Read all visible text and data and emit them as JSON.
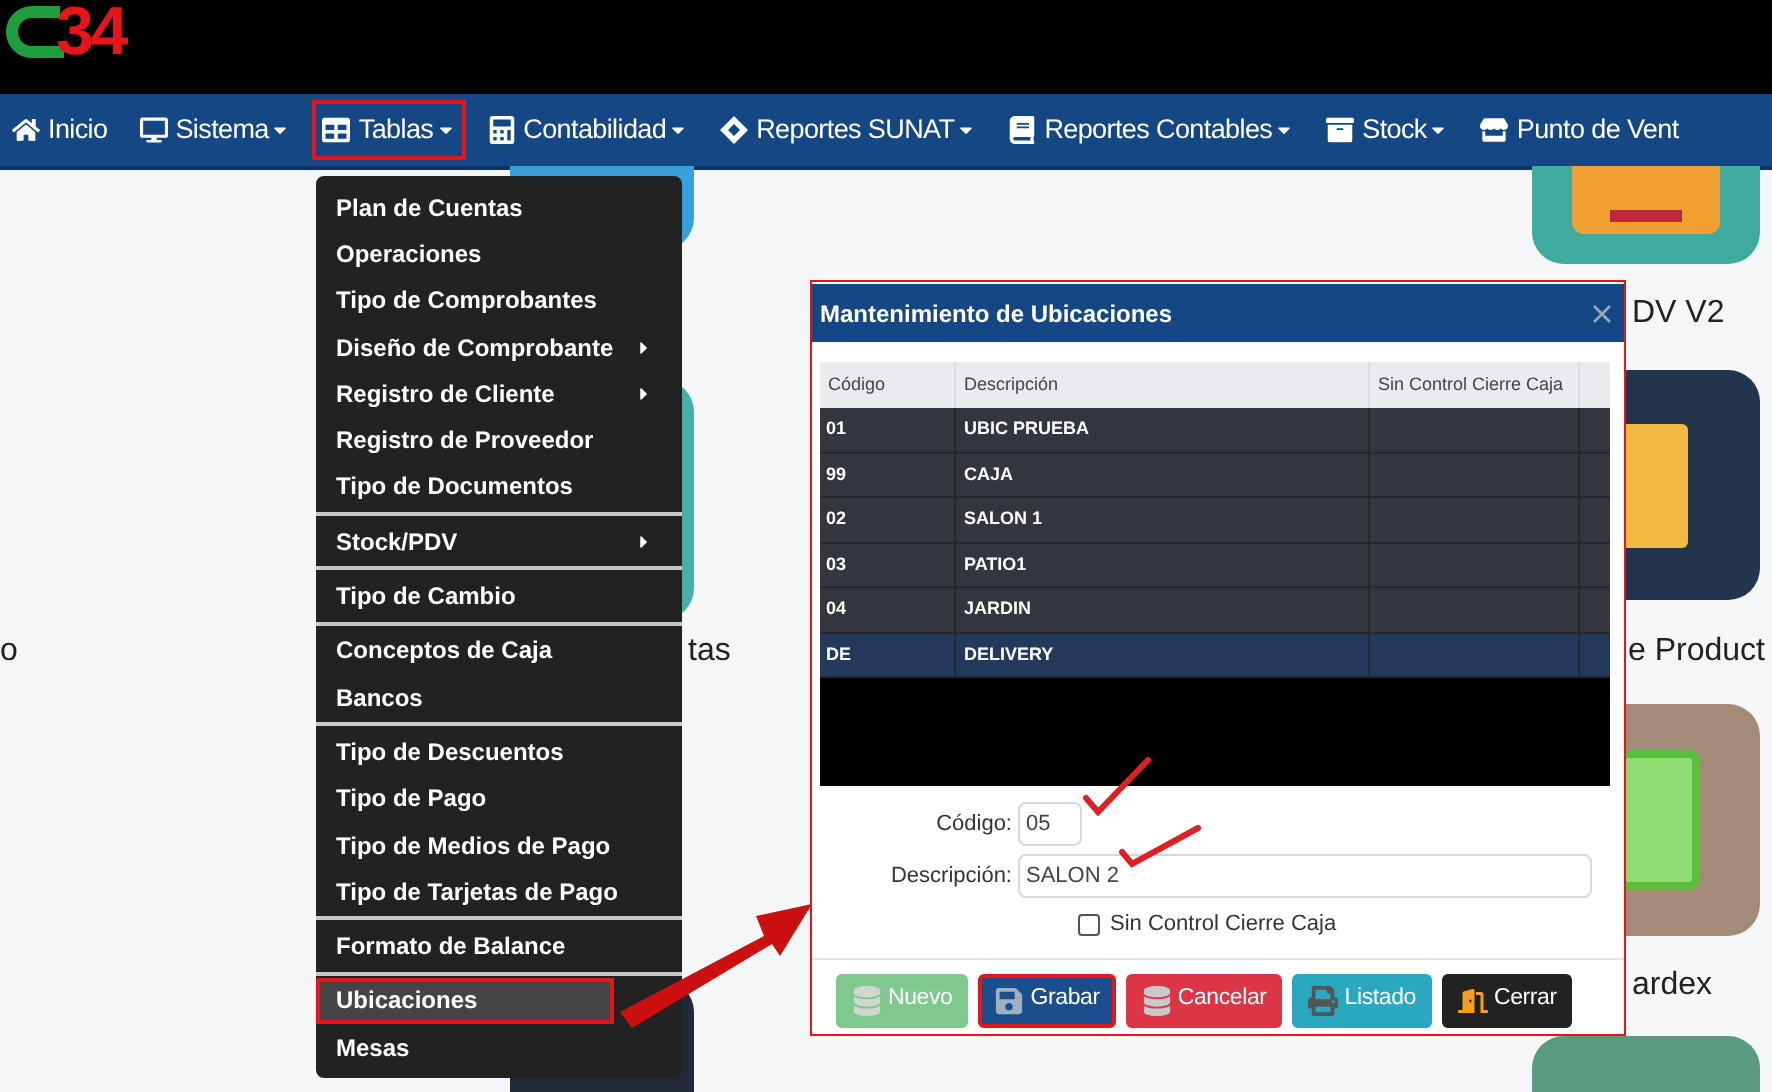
{
  "logo": {
    "text": "34"
  },
  "nav": [
    {
      "label": "Inicio",
      "dropdown": false,
      "selected": false
    },
    {
      "label": "Sistema",
      "dropdown": true,
      "selected": false
    },
    {
      "label": "Tablas",
      "dropdown": true,
      "selected": true
    },
    {
      "label": "Contabilidad",
      "dropdown": true,
      "selected": false
    },
    {
      "label": "Reportes SUNAT",
      "dropdown": true,
      "selected": false
    },
    {
      "label": "Reportes Contables",
      "dropdown": true,
      "selected": false
    },
    {
      "label": "Stock",
      "dropdown": true,
      "selected": false
    },
    {
      "label": "Punto de Vent",
      "dropdown": false,
      "selected": false
    }
  ],
  "tiles": [
    {
      "label": "o"
    },
    {
      "label": "tas"
    },
    {
      "label": "DV V2"
    },
    {
      "label": "e Product"
    },
    {
      "label": "ardex"
    }
  ],
  "menu": {
    "groups": [
      [
        {
          "label": "Plan de Cuentas",
          "submenu": false,
          "selected": false
        },
        {
          "label": "Operaciones",
          "submenu": false,
          "selected": false
        },
        {
          "label": "Tipo de Comprobantes",
          "submenu": false,
          "selected": false
        },
        {
          "label": "Diseño de Comprobante",
          "submenu": true,
          "selected": false
        },
        {
          "label": "Registro de Cliente",
          "submenu": true,
          "selected": false
        },
        {
          "label": "Registro de Proveedor",
          "submenu": false,
          "selected": false
        },
        {
          "label": "Tipo de Documentos",
          "submenu": false,
          "selected": false
        }
      ],
      [
        {
          "label": "Stock/PDV",
          "submenu": true,
          "selected": false
        }
      ],
      [
        {
          "label": "Tipo de Cambio",
          "submenu": false,
          "selected": false
        }
      ],
      [
        {
          "label": "Conceptos de Caja",
          "submenu": false,
          "selected": false
        },
        {
          "label": "Bancos",
          "submenu": false,
          "selected": false
        }
      ],
      [
        {
          "label": "Tipo de Descuentos",
          "submenu": false,
          "selected": false
        },
        {
          "label": "Tipo de Pago",
          "submenu": false,
          "selected": false
        },
        {
          "label": "Tipo de Medios de Pago",
          "submenu": false,
          "selected": false
        },
        {
          "label": "Tipo de Tarjetas de Pago",
          "submenu": false,
          "selected": false
        }
      ],
      [
        {
          "label": "Formato de Balance",
          "submenu": false,
          "selected": false
        }
      ],
      [
        {
          "label": "Ubicaciones",
          "submenu": false,
          "selected": true
        },
        {
          "label": "Mesas",
          "submenu": false,
          "selected": false
        }
      ]
    ]
  },
  "modal": {
    "title": "Mantenimiento de Ubicaciones",
    "columns": [
      "Código",
      "Descripción",
      "Sin Control Cierre Caja"
    ],
    "rows": [
      {
        "code": "01",
        "description": "UBIC PRUEBA",
        "selected": false
      },
      {
        "code": "99",
        "description": "CAJA",
        "selected": false
      },
      {
        "code": "02",
        "description": "SALON 1",
        "selected": false
      },
      {
        "code": "03",
        "description": "PATIO1",
        "selected": false
      },
      {
        "code": "04",
        "description": "JARDIN",
        "selected": false
      },
      {
        "code": "DE",
        "description": "DELIVERY",
        "selected": true
      }
    ],
    "fields": [
      {
        "label": "Código:",
        "value": "05",
        "kind": "short"
      },
      {
        "label": "Descripción:",
        "value": "SALON 2",
        "kind": "wide"
      }
    ],
    "checkbox": {
      "label": "Sin Control Cierre Caja",
      "checked": false
    },
    "buttons": [
      {
        "label": "Nuevo",
        "kind": "new",
        "color": "#7fc98f",
        "highlighted": false
      },
      {
        "label": "Grabar",
        "kind": "save",
        "color": "#1a4e8c",
        "highlighted": true
      },
      {
        "label": "Cancelar",
        "kind": "cancel",
        "color": "#dc3545",
        "highlighted": false
      },
      {
        "label": "Listado",
        "kind": "print",
        "color": "#2aa8c0",
        "highlighted": false
      },
      {
        "label": "Cerrar",
        "kind": "close",
        "color": "#222222",
        "highlighted": false
      }
    ]
  }
}
